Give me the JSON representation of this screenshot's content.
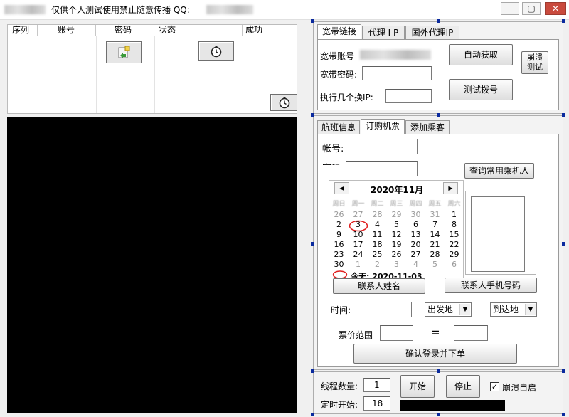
{
  "window": {
    "title": "仅供个人测试使用禁止随意传播 QQ:",
    "minimize_label": "—",
    "restore_label": "▢",
    "close_label": "✕"
  },
  "grid": {
    "columns": [
      "序列",
      "账号",
      "密码",
      "状态",
      "成功"
    ]
  },
  "net_tabs": [
    {
      "label": "宽带链接",
      "active": true
    },
    {
      "label": "代理 I P",
      "active": false
    },
    {
      "label": "国外代理IP",
      "active": false
    }
  ],
  "net_panel": {
    "account_label": "宽带账号",
    "password_label": "宽带密码:",
    "password_value": "",
    "count_label": "执行几个换IP:",
    "count_value": "",
    "auto_get_button": "自动获取",
    "test_dial_button": "测试拨号",
    "crash_test_button_line1": "崩溃",
    "crash_test_button_line2": "测试"
  },
  "order_tabs": [
    {
      "label": "航班信息",
      "active": false
    },
    {
      "label": "订购机票",
      "active": true
    },
    {
      "label": "添加乘客",
      "active": false
    }
  ],
  "order_panel": {
    "account_label": "帐号:",
    "account_value": "",
    "password_label_partial": "密码",
    "query_passengers_button": "查询常用乘机人",
    "contact_name_button": "联系人姓名",
    "contact_phone_button": "联系人手机号码",
    "time_label": "时间:",
    "time_value": "",
    "from_select": "出发地",
    "to_select": "到达地",
    "price_range_label": "票价范围",
    "price_from": "",
    "equals_sign": "=",
    "price_to": "",
    "confirm_button": "确认登录并下单"
  },
  "calendar": {
    "prev_label": "◀",
    "next_label": "▶",
    "month_title": "2020年11月",
    "weekdays": [
      "周日",
      "周一",
      "周二",
      "周三",
      "周四",
      "周五",
      "周六"
    ],
    "rows": [
      [
        {
          "d": "26",
          "dim": true
        },
        {
          "d": "27",
          "dim": true
        },
        {
          "d": "28",
          "dim": true
        },
        {
          "d": "29",
          "dim": true
        },
        {
          "d": "30",
          "dim": true
        },
        {
          "d": "31",
          "dim": true
        },
        {
          "d": "1",
          "dim": false
        }
      ],
      [
        {
          "d": "2",
          "dim": false
        },
        {
          "d": "3",
          "dim": false
        },
        {
          "d": "4",
          "dim": false
        },
        {
          "d": "5",
          "dim": false
        },
        {
          "d": "6",
          "dim": false
        },
        {
          "d": "7",
          "dim": false
        },
        {
          "d": "8",
          "dim": false
        }
      ],
      [
        {
          "d": "9",
          "dim": false
        },
        {
          "d": "10",
          "dim": false
        },
        {
          "d": "11",
          "dim": false
        },
        {
          "d": "12",
          "dim": false
        },
        {
          "d": "13",
          "dim": false
        },
        {
          "d": "14",
          "dim": false
        },
        {
          "d": "15",
          "dim": false
        }
      ],
      [
        {
          "d": "16",
          "dim": false
        },
        {
          "d": "17",
          "dim": false
        },
        {
          "d": "18",
          "dim": false
        },
        {
          "d": "19",
          "dim": false
        },
        {
          "d": "20",
          "dim": false
        },
        {
          "d": "21",
          "dim": false
        },
        {
          "d": "22",
          "dim": false
        }
      ],
      [
        {
          "d": "23",
          "dim": false
        },
        {
          "d": "24",
          "dim": false
        },
        {
          "d": "25",
          "dim": false
        },
        {
          "d": "26",
          "dim": false
        },
        {
          "d": "27",
          "dim": false
        },
        {
          "d": "28",
          "dim": false
        },
        {
          "d": "29",
          "dim": false
        }
      ],
      [
        {
          "d": "30",
          "dim": false
        },
        {
          "d": "1",
          "dim": true
        },
        {
          "d": "2",
          "dim": true
        },
        {
          "d": "3",
          "dim": true
        },
        {
          "d": "4",
          "dim": true
        },
        {
          "d": "5",
          "dim": true
        },
        {
          "d": "6",
          "dim": true
        }
      ]
    ],
    "selected_day": "3",
    "today_text": "今天: 2020-11-03",
    "today_circle_color": "#e02020"
  },
  "bottom_panel": {
    "threads_label": "线程数量:",
    "threads_value": "1",
    "timer_label": "定时开始:",
    "timer_value": "18",
    "start_button": "开始",
    "stop_button": "停止",
    "crash_restart_label": "崩溃自启",
    "crash_restart_checked": true,
    "check_mark": "✓"
  },
  "icons": {
    "password_cell": "key-edit-icon",
    "status_cell": "stopwatch-icon",
    "success_cell": "stopwatch-icon"
  },
  "colors": {
    "console_bg": "#000000",
    "selection_handle": "#0a2a9e",
    "close_button": "#c94a3d"
  }
}
